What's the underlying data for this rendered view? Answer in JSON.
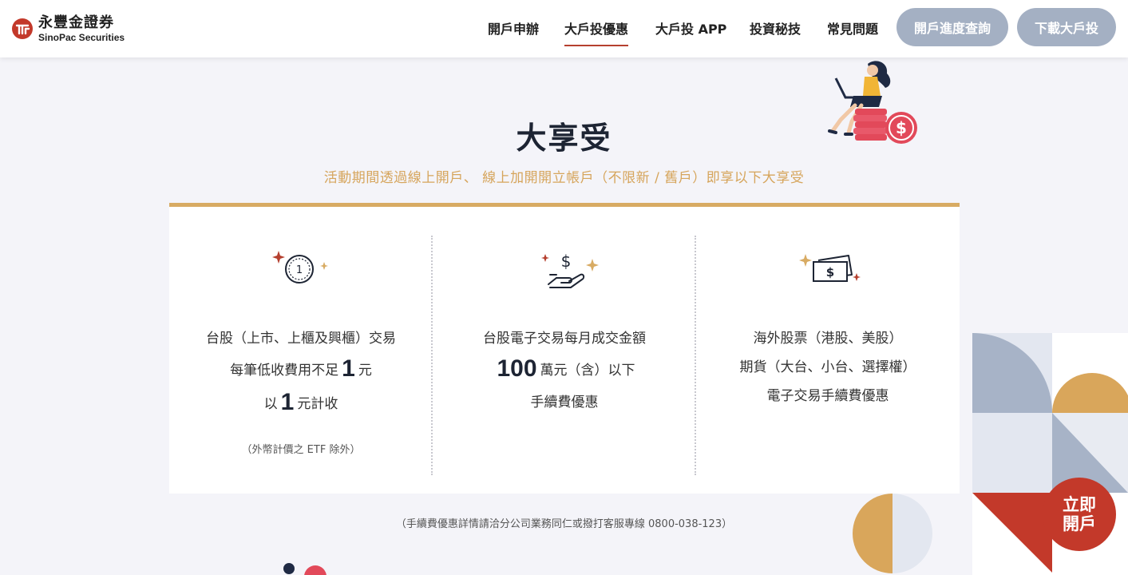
{
  "brand": {
    "name_zh": "永豐金證券",
    "name_en": "SinoPac Securities",
    "color_primary": "#c3392a",
    "color_gold": "#d8ab63"
  },
  "nav": {
    "items": [
      {
        "label": "開戶申辦"
      },
      {
        "label": "大戶投優惠",
        "active": true
      },
      {
        "label": "大戶投 APP"
      },
      {
        "label": "投資秘技"
      },
      {
        "label": "常見問題"
      }
    ],
    "pill_progress": "開戶進度查詢",
    "pill_download": "下載大戶投"
  },
  "hero": {
    "title": "大享受",
    "subtitle": "活動期間透過線上開戶、 線上加開開立帳戶（不限新 / 舊戶）即享以下大享受"
  },
  "benefits": {
    "col1": {
      "icon": "coin-one-icon",
      "line1": "台股（上市、上櫃及興櫃）交易",
      "line2_pre": "每筆低收費用不足",
      "line2_num": "1",
      "line2_post": "元",
      "line3_pre": "以",
      "line3_num": "1",
      "line3_post": "元計收",
      "note": "（外幣計價之 ETF 除外）"
    },
    "col2": {
      "icon": "hand-dollar-icon",
      "line1": "台股電子交易每月成交金額",
      "line2_num": "100",
      "line2_post": "萬元（含）以下",
      "line3": "手續費優惠"
    },
    "col3": {
      "icon": "banknote-icon",
      "line1": "海外股票（港股、美股）",
      "line2": "期貨（大台、小台、選擇權）",
      "line3": "電子交易手續費優惠"
    }
  },
  "footnote": "（手續費優惠詳情請洽分公司業務同仁或撥打客服專線 0800-038-123）",
  "cta": {
    "line1": "立即",
    "line2": "開戶"
  }
}
